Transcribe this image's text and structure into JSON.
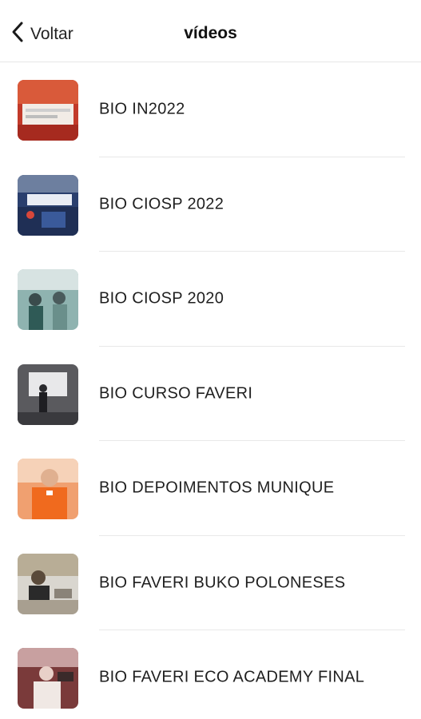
{
  "header": {
    "back_label": "Voltar",
    "title": "vídeos"
  },
  "videos": [
    {
      "title": "BIO IN2022"
    },
    {
      "title": "BIO CIOSP 2022"
    },
    {
      "title": "BIO CIOSP 2020"
    },
    {
      "title": "BIO CURSO FAVERI"
    },
    {
      "title": "BIO DEPOIMENTOS MUNIQUE"
    },
    {
      "title": "BIO FAVERI BUKO POLONESES"
    },
    {
      "title": "BIO FAVERI ECO ACADEMY FINAL"
    }
  ]
}
